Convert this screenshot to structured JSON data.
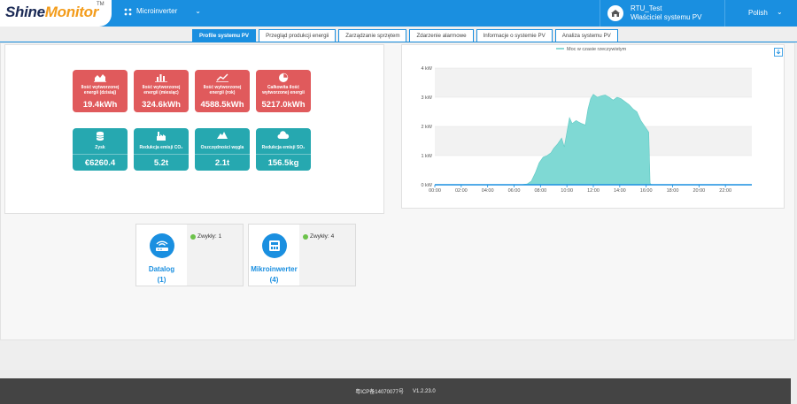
{
  "header": {
    "logo_text_a": "Shine",
    "logo_text_b": "Monitor",
    "logo_tm": "TM",
    "plant_name": "Microinverter",
    "user_name": "RTU_Test",
    "user_role": "Właściciel systemu PV",
    "language": "Polish"
  },
  "tabs": [
    {
      "label": "Profile systemu PV",
      "active": true
    },
    {
      "label": "Przegląd produkcji energii",
      "active": false
    },
    {
      "label": "Zarządzanie sprzętem",
      "active": false
    },
    {
      "label": "Zdarzenie alarmowe",
      "active": false
    },
    {
      "label": "Informacje o systemie PV",
      "active": false
    },
    {
      "label": "Analiza systemu PV",
      "active": false
    }
  ],
  "energy_tiles": [
    {
      "label": "Ilość wytworzonej energii (dzisiaj)",
      "value": "19.4kWh",
      "icon": "area-chart-icon",
      "color": "#e05a5c"
    },
    {
      "label": "Ilość wytworzonej energii (miesiąc)",
      "value": "324.6kWh",
      "icon": "bar-chart-icon",
      "color": "#e05a5c"
    },
    {
      "label": "Ilość wytworzonej energii (rok)",
      "value": "4588.5kWh",
      "icon": "line-chart-icon",
      "color": "#e05a5c"
    },
    {
      "label": "Całkowita ilość wytworzonej energii",
      "value": "5217.0kWh",
      "icon": "pie-chart-icon",
      "color": "#e05a5c"
    }
  ],
  "stat_tiles": [
    {
      "label": "Zysk",
      "value": "€6260.4",
      "icon": "coins-icon",
      "color": "#26a8b0"
    },
    {
      "label": "Redukcja emisji CO₂",
      "value": "5.2t",
      "icon": "factory-icon",
      "color": "#26a8b0"
    },
    {
      "label": "Oszczędności węgla",
      "value": "2.1t",
      "icon": "coal-icon",
      "color": "#26a8b0"
    },
    {
      "label": "Redukcja emisji SO₂",
      "value": "156.5kg",
      "icon": "cloud-icon",
      "color": "#26a8b0"
    }
  ],
  "devices": [
    {
      "name": "Datalog",
      "count": "(1)",
      "status_label": "Zwykły:",
      "status_count": "1",
      "icon": "router-icon"
    },
    {
      "name": "Mikroinwerter",
      "count": "(4)",
      "status_label": "Zwykły:",
      "status_count": "4",
      "icon": "inverter-icon"
    }
  ],
  "footer": {
    "icp": "粤ICP备14070077号",
    "version": "V1.2.23.0"
  },
  "chart_data": {
    "type": "area",
    "title": "",
    "legend": [
      "Moc w czasie rzeczywistym"
    ],
    "legend_position": "top-center",
    "xlabel": "",
    "ylabel": "",
    "x_ticks": [
      "00:00",
      "02:00",
      "04:00",
      "06:00",
      "08:00",
      "10:00",
      "12:00",
      "14:00",
      "16:00",
      "18:00",
      "20:00",
      "22:00"
    ],
    "y_ticks": [
      "0 kW",
      "1 kW",
      "2 kW",
      "3 kW",
      "4 kW"
    ],
    "ylim": [
      0,
      4
    ],
    "xlim_hours": [
      0,
      24
    ],
    "grid": true,
    "color": "#7fd9d4",
    "series": [
      {
        "name": "Moc w czasie rzeczywistym",
        "points": [
          [
            6.5,
            0
          ],
          [
            7.0,
            0.03
          ],
          [
            7.3,
            0.12
          ],
          [
            7.6,
            0.4
          ],
          [
            7.9,
            0.75
          ],
          [
            8.2,
            0.95
          ],
          [
            8.5,
            1.0
          ],
          [
            8.8,
            1.1
          ],
          [
            9.0,
            1.25
          ],
          [
            9.3,
            1.4
          ],
          [
            9.6,
            1.6
          ],
          [
            9.8,
            1.3
          ],
          [
            10.0,
            1.8
          ],
          [
            10.2,
            2.3
          ],
          [
            10.4,
            2.1
          ],
          [
            10.7,
            2.2
          ],
          [
            10.9,
            2.15
          ],
          [
            11.1,
            2.1
          ],
          [
            11.4,
            2.05
          ],
          [
            11.6,
            2.6
          ],
          [
            11.8,
            2.95
          ],
          [
            12.0,
            3.1
          ],
          [
            12.3,
            3.0
          ],
          [
            12.6,
            3.05
          ],
          [
            12.9,
            3.08
          ],
          [
            13.2,
            3.0
          ],
          [
            13.5,
            2.9
          ],
          [
            13.8,
            3.0
          ],
          [
            14.1,
            2.95
          ],
          [
            14.4,
            2.85
          ],
          [
            14.7,
            2.75
          ],
          [
            15.0,
            2.6
          ],
          [
            15.3,
            2.5
          ],
          [
            15.6,
            2.2
          ],
          [
            15.9,
            2.0
          ],
          [
            16.2,
            1.8
          ],
          [
            16.3,
            0.05
          ],
          [
            16.4,
            0
          ]
        ]
      }
    ]
  }
}
